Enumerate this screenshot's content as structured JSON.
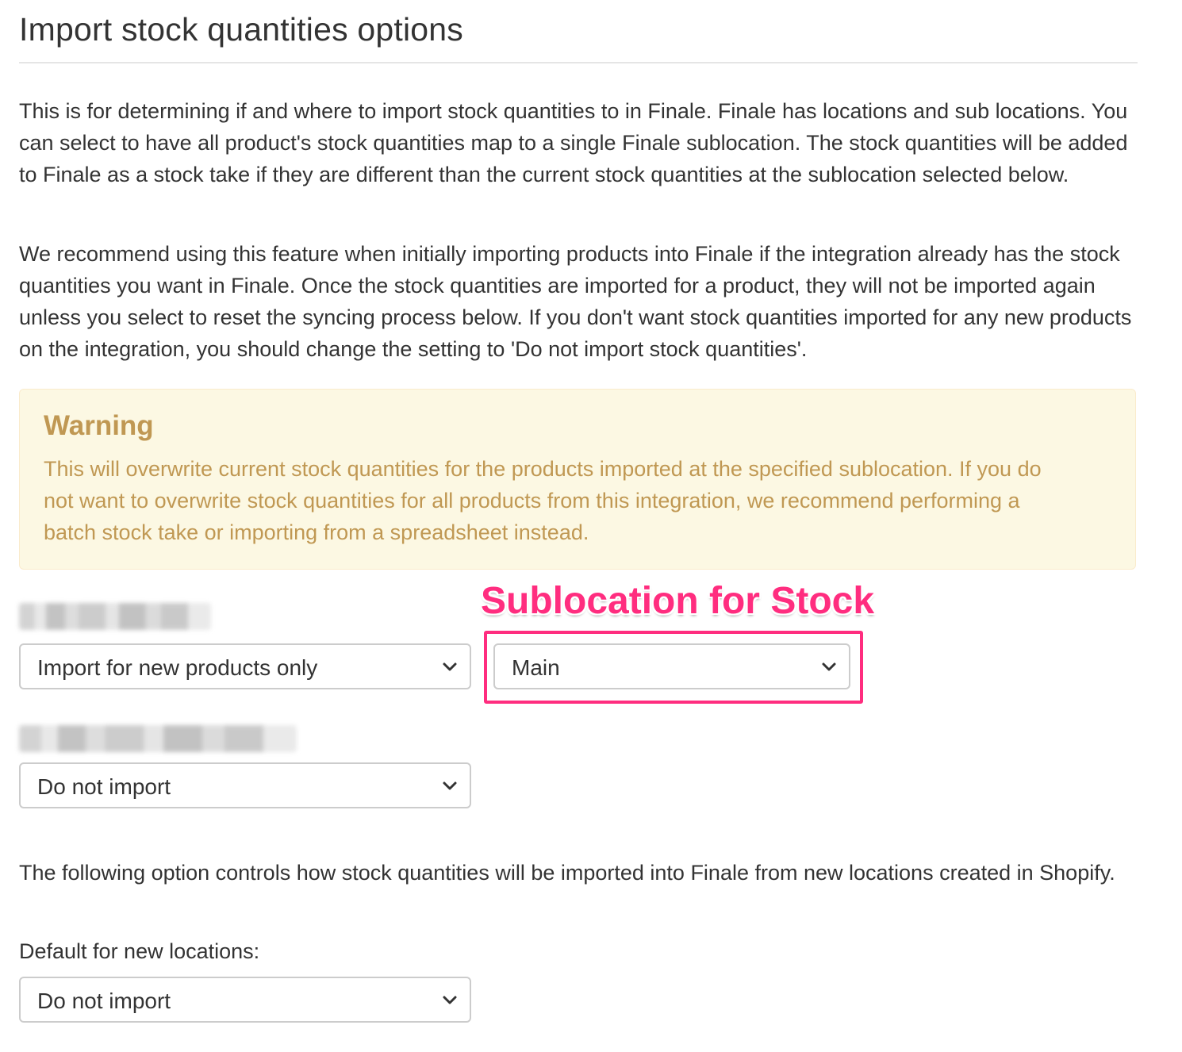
{
  "page": {
    "title": "Import stock quantities options",
    "intro_paragraph": "This is for determining if and where to import stock quantities to in Finale. Finale has locations and sub locations. You can select to have all product's stock quantities map to a single Finale sublocation. The stock quantities will be added to Finale as a stock take if they are different than the current stock quantities at the sublocation selected below.",
    "recommend_paragraph": "We recommend using this feature when initially importing products into Finale if the integration already has the stock quantities you want in Finale. Once the stock quantities are imported for a product, they will not be imported again unless you select to reset the syncing process below. If you don't want stock quantities imported for any new products on the integration, you should change the setting to 'Do not import stock quantities'."
  },
  "warning": {
    "title": "Warning",
    "text": "This will overwrite current stock quantities for the products imported at the specified sublocation. If you do not want to overwrite stock quantities for all products from this integration, we recommend performing a batch stock take or importing from a spreadsheet instead."
  },
  "import_select": {
    "value": "Import for new products only"
  },
  "sublocation_select": {
    "value": "Main"
  },
  "second_select": {
    "value": "Do not import"
  },
  "annotation": {
    "label": "Sublocation for Stock",
    "color": "#ff2d7f"
  },
  "new_locations": {
    "description": "The following option controls how stock quantities will be imported into Finale from new locations created in Shopify.",
    "label": "Default for new locations:",
    "value": "Do not import"
  },
  "colors": {
    "warning_background": "#fcf8e3",
    "warning_text": "#c09853"
  }
}
